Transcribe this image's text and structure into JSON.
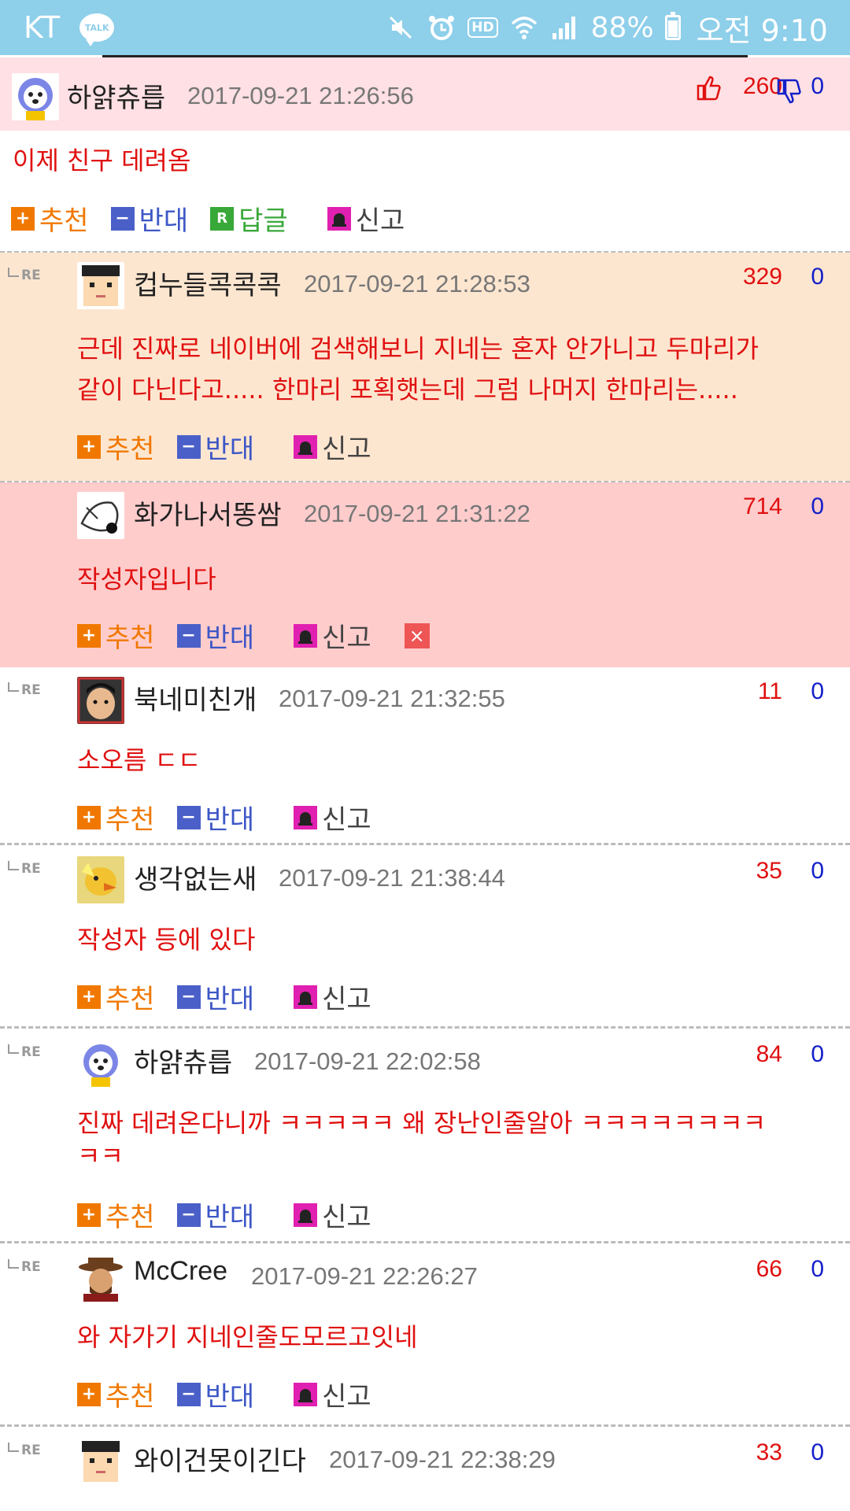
{
  "status_bar": {
    "carrier": "KT",
    "talk_label": "TALK",
    "hd_label": "HD",
    "battery": "88%",
    "time": "오전 9:10"
  },
  "actions": {
    "recommend": "추천",
    "oppose": "반대",
    "reply": "답글",
    "report": "신고",
    "re": "RE",
    "delete": "×"
  },
  "comments": [
    {
      "nick": "하얅츄릅",
      "date": "2017-09-21 21:26:56",
      "likes": "260",
      "dislikes": "0",
      "text": "이제 친구 데려옴"
    },
    {
      "nick": "컵누들콕콕콕",
      "date": "2017-09-21 21:28:53",
      "likes": "329",
      "dislikes": "0",
      "text_lines": [
        "근데 진짜로 네이버에 검색해보니 지네는 혼자 안가니고 두마리가",
        "같이 다닌다고..... 한마리 포획햇는데 그럼 나머지 한마리는....."
      ]
    },
    {
      "nick": "화가나서똥쌈",
      "date": "2017-09-21 21:31:22",
      "likes": "714",
      "dislikes": "0",
      "text": "작성자입니다"
    },
    {
      "nick": "북네미친개",
      "date": "2017-09-21 21:32:55",
      "likes": "11",
      "dislikes": "0",
      "text": "소오름 ㄷㄷ"
    },
    {
      "nick": "생각없는새",
      "date": "2017-09-21 21:38:44",
      "likes": "35",
      "dislikes": "0",
      "text": "작성자 등에 있다"
    },
    {
      "nick": "하얅츄릅",
      "date": "2017-09-21 22:02:58",
      "likes": "84",
      "dislikes": "0",
      "text_lines": [
        "진짜 데려온다니까 ㅋㅋㅋㅋㅋ 왜 장난인줄알아 ㅋㅋㅋㅋㅋㅋㅋㅋ",
        "ㅋㅋ"
      ]
    },
    {
      "nick": "McCree",
      "date": "2017-09-21 22:26:27",
      "likes": "66",
      "dislikes": "0",
      "text": "와 자가기 지네인줄도모르고잇네"
    },
    {
      "nick": "와이건못이긴다",
      "date": "2017-09-21 22:38:29",
      "likes": "33",
      "dislikes": "0"
    }
  ]
}
